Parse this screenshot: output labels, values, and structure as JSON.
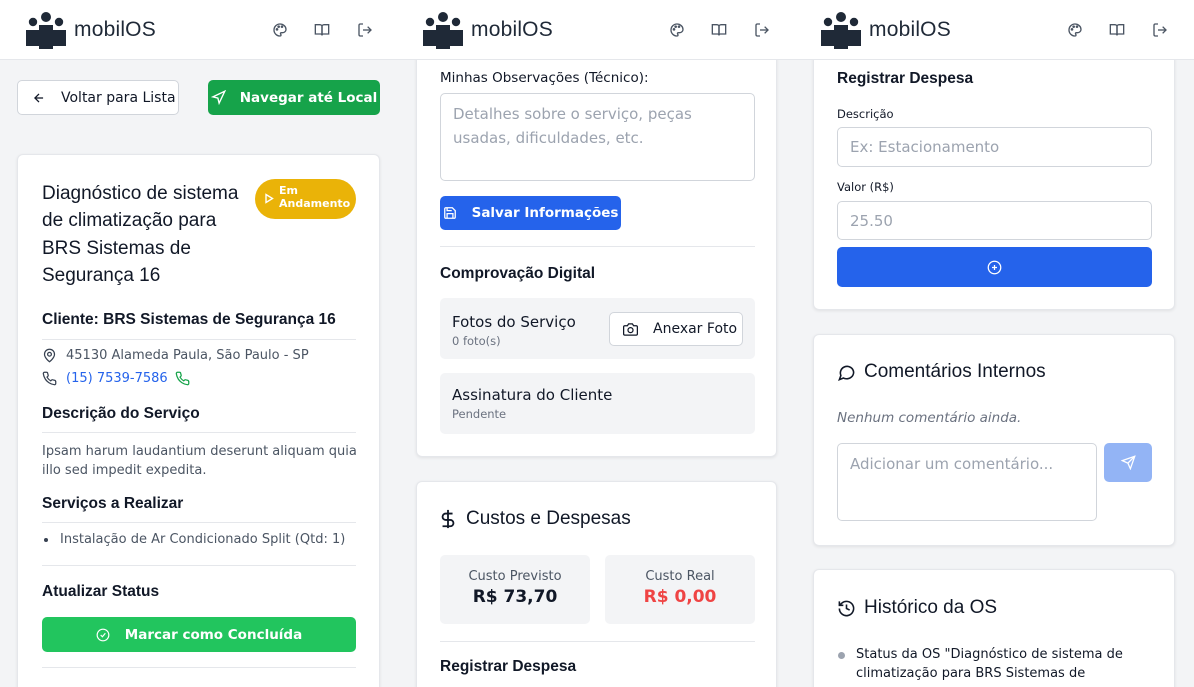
{
  "app": {
    "name": "mobilOS"
  },
  "colors": {
    "green": "#16a34a",
    "blue": "#2563eb",
    "amber": "#eab308",
    "red": "#ef4444",
    "phone_link": "#2563eb"
  },
  "toolbar_icons": [
    "palette-icon",
    "book-icon",
    "logout-icon"
  ],
  "pane1": {
    "back_button": "Voltar para Lista",
    "navigate_button": "Navegar até Local",
    "title_lines": [
      "Diagnóstico de sistema",
      "de climatização para",
      "BRS Sistemas de",
      "Segurança 16"
    ],
    "status_badge": {
      "line1": "Em",
      "line2": "Andamento"
    },
    "client_label": "Cliente: BRS Sistemas de Segurança 16",
    "address": "45130 Alameda Paula, São Paulo - SP",
    "phone": "(15) 7539-7586",
    "description_heading": "Descrição do Serviço",
    "description_lines": [
      "Ipsam harum laudantium deserunt aliquam quia",
      "illo sed impedit expedita."
    ],
    "services_heading": "Serviços a Realizar",
    "services": [
      "Instalação de Ar Condicionado Split (Qtd: 1)"
    ],
    "update_status_heading": "Atualizar Status",
    "complete_button": "Marcar como Concluída"
  },
  "pane2": {
    "observations_label": "Minhas Observações (Técnico):",
    "observations_placeholder_lines": [
      "Detalhes sobre o serviço, peças",
      "usadas, dificuldades, etc."
    ],
    "save_button": "Salvar Informações",
    "digital_proof_heading": "Comprovação Digital",
    "photos": {
      "title": "Fotos do Serviço",
      "count": "0 foto(s)",
      "attach_button": "Anexar Foto"
    },
    "signature": {
      "title": "Assinatura do Cliente",
      "status": "Pendente"
    },
    "costs_heading": "Custos e Despesas",
    "estimated": {
      "label": "Custo Previsto",
      "value": "R$ 73,70"
    },
    "actual": {
      "label": "Custo Real",
      "value": "R$ 0,00"
    },
    "register_expense_heading": "Registrar Despesa"
  },
  "pane3": {
    "register_expense_heading": "Registrar Despesa",
    "description_label": "Descrição",
    "description_placeholder": "Ex: Estacionamento",
    "value_label": "Valor (R$)",
    "value_placeholder": "25.50",
    "comments_heading": "Comentários Internos",
    "no_comments": "Nenhum comentário ainda.",
    "comment_placeholder": "Adicionar um comentário...",
    "history_heading": "Histórico da OS",
    "history_lines": [
      "Status da OS \"Diagnóstico de sistema de",
      "climatização para BRS Sistemas de"
    ]
  }
}
